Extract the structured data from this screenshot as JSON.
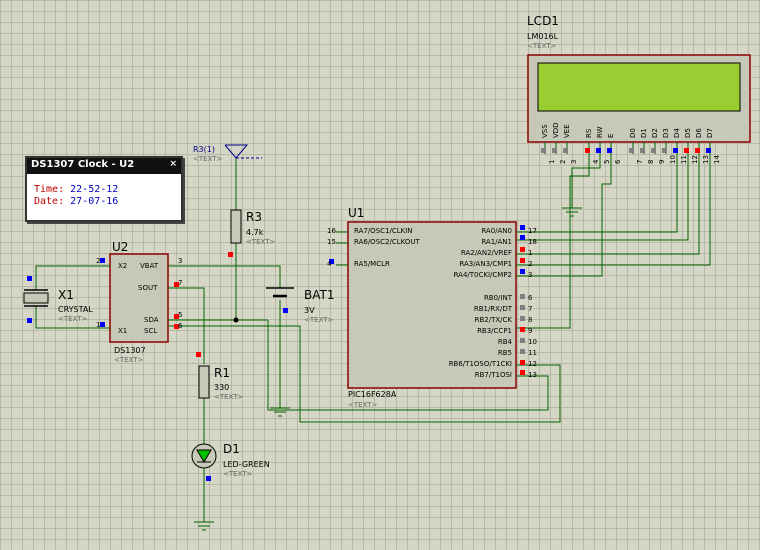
{
  "clock_window": {
    "title": "DS1307 Clock - U2",
    "close": "×",
    "time_label": "Time:",
    "time_value": "22-52-12",
    "date_label": "Date:",
    "date_value": "27-07-16"
  },
  "lcd": {
    "ref": "LCD1",
    "value": "LM016L",
    "text": "<TEXT>",
    "pin_names": [
      "VSS",
      "VDD",
      "VEE",
      "RS",
      "RW",
      "E",
      "D0",
      "D1",
      "D2",
      "D3",
      "D4",
      "D5",
      "D6",
      "D7"
    ],
    "pin_numbers": [
      "1",
      "2",
      "3",
      "4",
      "5",
      "6",
      "7",
      "8",
      "9",
      "10",
      "11",
      "12",
      "13",
      "14"
    ]
  },
  "u1": {
    "ref": "U1",
    "value": "PIC16F628A",
    "text": "<TEXT>",
    "left_pins": [
      {
        "name": "RA7/OSC1/CLKIN",
        "num": "16"
      },
      {
        "name": "RA6/OSC2/CLKOUT",
        "num": "15"
      },
      {
        "name": "RA5/MCLR",
        "num": "4"
      }
    ],
    "right_pins": [
      {
        "name": "RA0/AN0",
        "num": "17"
      },
      {
        "name": "RA1/AN1",
        "num": "18"
      },
      {
        "name": "RA2/AN2/VREF",
        "num": "1"
      },
      {
        "name": "RA3/AN3/CMP1",
        "num": "2"
      },
      {
        "name": "RA4/T0CKI/CMP2",
        "num": "3"
      },
      {
        "name": "RB0/INT",
        "num": "6"
      },
      {
        "name": "RB1/RX/DT",
        "num": "7"
      },
      {
        "name": "RB2/TX/CK",
        "num": "8"
      },
      {
        "name": "RB3/CCP1",
        "num": "9"
      },
      {
        "name": "RB4",
        "num": "10"
      },
      {
        "name": "RB5",
        "num": "11"
      },
      {
        "name": "RB6/T1OSO/T1CKI",
        "num": "12"
      },
      {
        "name": "RB7/T1OSI",
        "num": "13"
      }
    ]
  },
  "u2": {
    "ref": "U2",
    "value": "DS1307",
    "text": "<TEXT>",
    "pins": {
      "x2": "X2",
      "x1": "X1",
      "vbat": "VBAT",
      "sout": "SOUT",
      "sda": "SDA",
      "scl": "SCL"
    },
    "nums": {
      "x2": "2",
      "x1": "1",
      "vbat": "3",
      "sout": "7",
      "sda": "5",
      "scl": "6"
    }
  },
  "x1": {
    "ref": "X1",
    "value": "CRYSTAL",
    "text": "<TEXT>"
  },
  "r3": {
    "ref": "R3",
    "value": "4.7k",
    "text": "<TEXT>"
  },
  "r1": {
    "ref": "R1",
    "value": "330",
    "text": "<TEXT>"
  },
  "bat1": {
    "ref": "BAT1",
    "value": "3V",
    "text": "<TEXT>"
  },
  "d1": {
    "ref": "D1",
    "value": "LED-GREEN",
    "text": "<TEXT>"
  },
  "power_terminal": {
    "label": "R3(1)",
    "text": "<TEXT>"
  },
  "colors": {
    "wire": "#006400",
    "component": "#8b0000",
    "lcd_screen": "#9acd32",
    "grid_bg": "#d6d6c6",
    "pin_high": "#ff0000",
    "pin_low": "#0000ff",
    "pin_float": "#808080"
  }
}
